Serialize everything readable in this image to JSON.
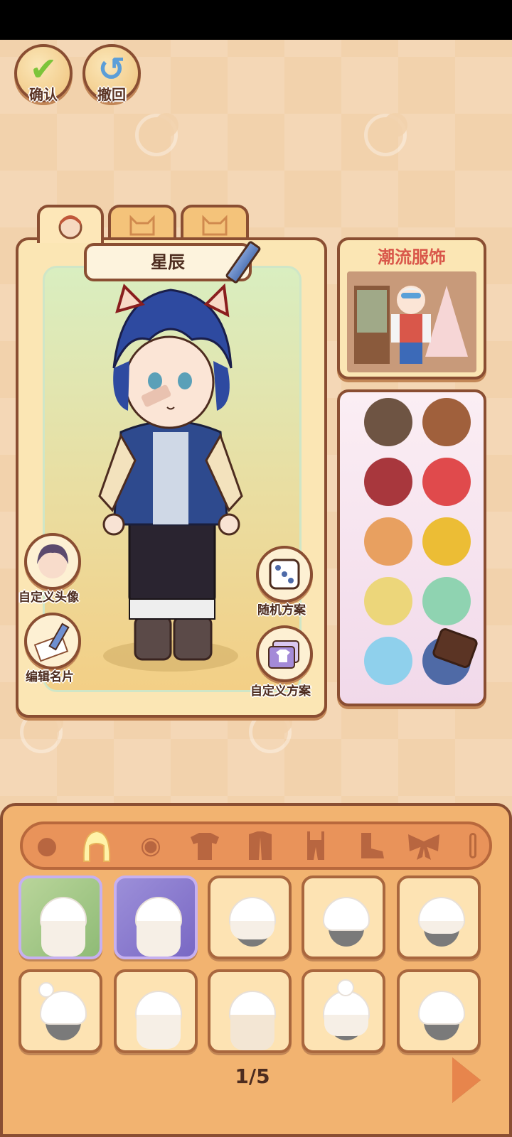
{
  "toolbar": {
    "confirm_label": "确认",
    "undo_label": "撤回"
  },
  "character": {
    "name": "星辰"
  },
  "side_actions": {
    "custom_avatar": "自定义头像",
    "edit_card": "编辑名片",
    "random_scheme": "随机方案",
    "custom_scheme": "自定义方案"
  },
  "promo": {
    "title": "潮流服饰"
  },
  "palette": {
    "colors": [
      "#6e5443",
      "#a0603c",
      "#a8373d",
      "#e04a4c",
      "#e8a060",
      "#ecbd35",
      "#ecd67a",
      "#8fd3b1",
      "#8fd0ec",
      "#4f6aa6"
    ]
  },
  "categories": [
    "face-category-icon",
    "hair-category-icon",
    "eye-category-icon",
    "top-category-icon",
    "coat-category-icon",
    "pants-category-icon",
    "shoes-category-icon",
    "bow-accessory-icon"
  ],
  "pagination": {
    "page": "1/5"
  }
}
